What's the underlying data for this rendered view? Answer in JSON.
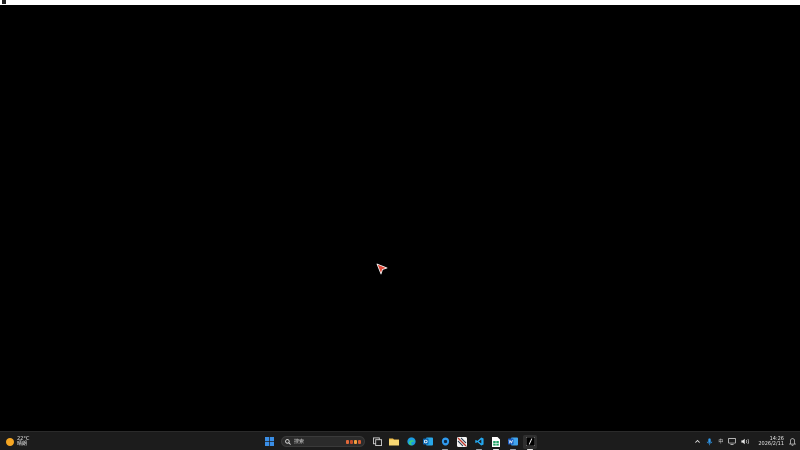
{
  "window": {
    "title": ""
  },
  "weather": {
    "temperature": "22°C",
    "condition": "晴朗",
    "icon": "sun-icon",
    "icon_color": "#f5a623"
  },
  "taskbar": {
    "start_icon": "windows-start-icon",
    "search_placeholder": "搜索",
    "search_icon": "search-icon",
    "apps": [
      {
        "name": "task-view-icon"
      },
      {
        "name": "file-explorer-icon"
      },
      {
        "name": "edge-browser-icon"
      },
      {
        "name": "outlook-icon"
      },
      {
        "name": "app-blue-icon"
      },
      {
        "name": "app-striped-icon"
      },
      {
        "name": "vscode-icon"
      },
      {
        "name": "spreadsheet-icon"
      },
      {
        "name": "word-icon"
      },
      {
        "name": "terminal-icon"
      }
    ],
    "colors": {
      "taskbar_bg": "#1c1c1c",
      "accent_blue": "#3a8ee6",
      "start_blue": "#2f7de1"
    }
  },
  "tray": {
    "overflow_icon": "chevron-up-icon",
    "mic_icon": "microphone-icon",
    "ime_label": "中",
    "display_icon": "display-icon",
    "volume_icon": "volume-icon",
    "time": "14:26",
    "date": "2026/2/11",
    "notification_icon": "notification-bell-icon"
  },
  "cursor": {
    "icon": "mouse-pointer-icon",
    "color": "#e04a3a"
  }
}
